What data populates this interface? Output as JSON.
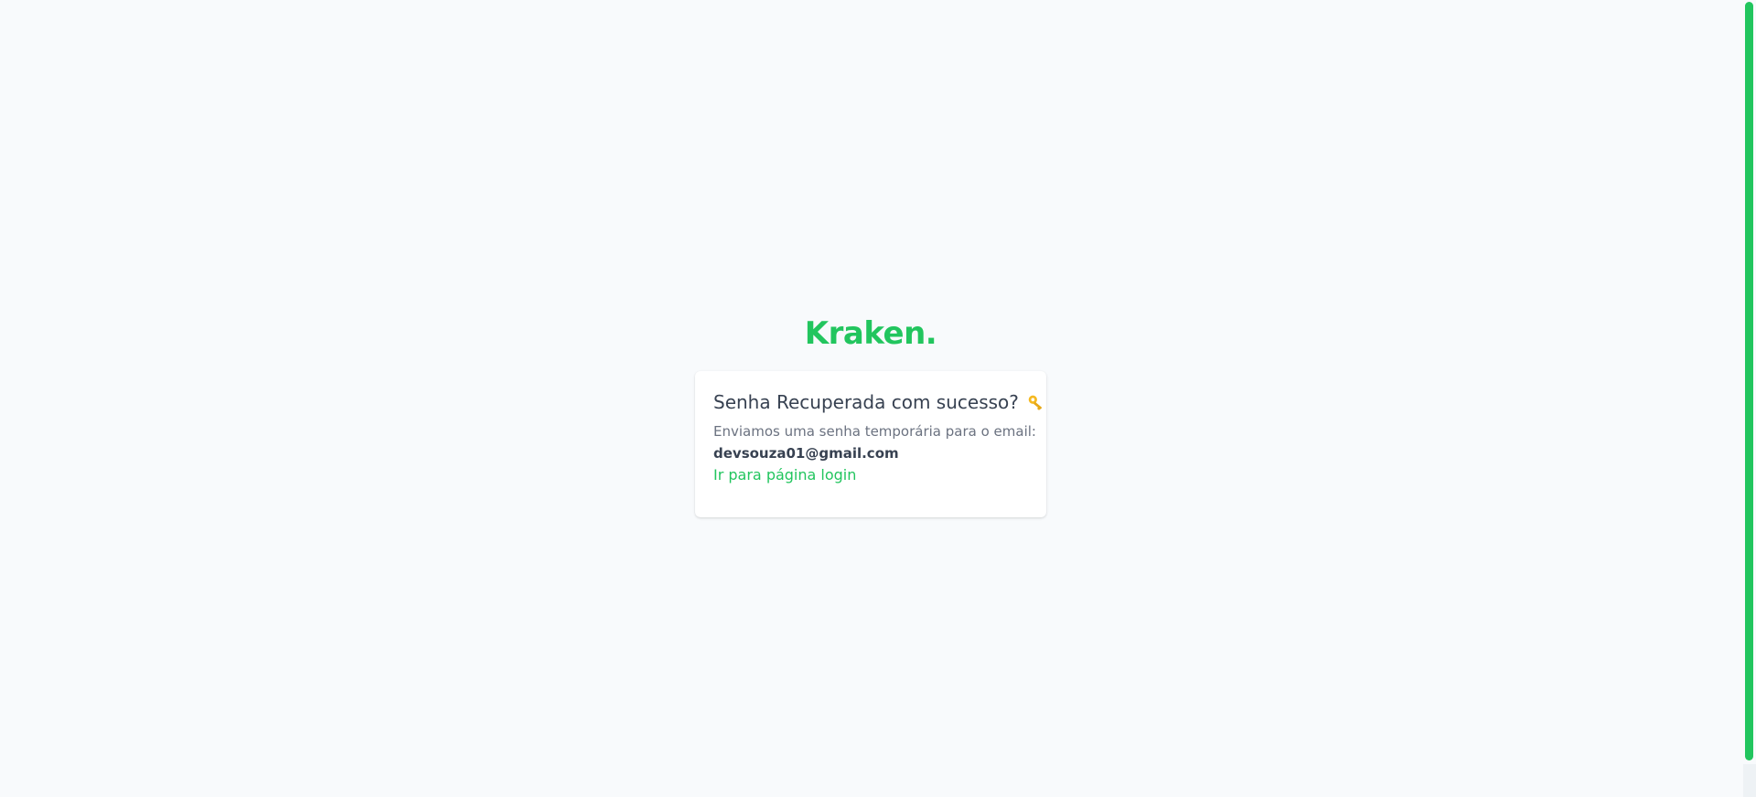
{
  "brand": {
    "logo_text": "Kraken.",
    "color": "#22c55e"
  },
  "card": {
    "title": "Senha Recuperada com sucesso?",
    "title_icon": "key-icon",
    "message": "Enviamos uma senha temporária para o email:",
    "email": "devsouza01@gmail.com",
    "login_link_label": "Ir para página login"
  },
  "colors": {
    "background": "#f8fafc",
    "accent": "#22c55e",
    "text_dark": "#374151",
    "text_muted": "#6b7280",
    "key_icon": "#f5b921"
  },
  "scrollbar": {
    "thumb_color": "#22c55e"
  }
}
